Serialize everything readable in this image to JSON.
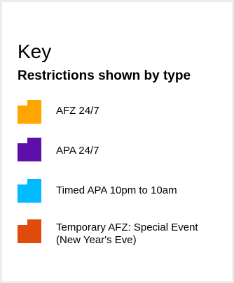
{
  "key": {
    "title": "Key",
    "subtitle": "Restrictions shown by type",
    "items": [
      {
        "label": "AFZ 24/7",
        "color": "#FFA500",
        "icon": "zone-swatch-icon"
      },
      {
        "label": "APA 24/7",
        "color": "#5E0FAA",
        "icon": "zone-swatch-icon"
      },
      {
        "label": "Timed APA 10pm to 10am",
        "color": "#00BBFF",
        "icon": "zone-swatch-icon"
      },
      {
        "label": "Temporary AFZ: Special Event (New Year's Eve)",
        "color": "#E04A0B",
        "icon": "zone-swatch-icon"
      }
    ]
  }
}
